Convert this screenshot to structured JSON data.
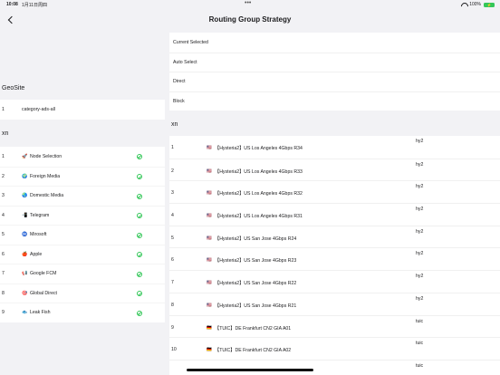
{
  "status": {
    "time": "10:08",
    "date": "1月11日周四",
    "battery": "100%"
  },
  "nav": {
    "title": "Routing Group Strategy"
  },
  "geosite": {
    "header": "GeoSite",
    "items": [
      {
        "num": "1",
        "label": "category-ads-all"
      }
    ]
  },
  "left_xn": {
    "header": "xn",
    "items": [
      {
        "num": "1",
        "icon": "🚀",
        "label": "Node Selection"
      },
      {
        "num": "2",
        "icon": "🌍",
        "label": "Foreign Media"
      },
      {
        "num": "3",
        "icon": "🌏",
        "label": "Domestic Media"
      },
      {
        "num": "4",
        "icon": "📲",
        "label": "Telegram"
      },
      {
        "num": "5",
        "icon": "Ⓜ️",
        "label": "Mirosoft"
      },
      {
        "num": "6",
        "icon": "🍎",
        "label": "Apple"
      },
      {
        "num": "7",
        "icon": "📢",
        "label": "Google FCM"
      },
      {
        "num": "8",
        "icon": "🎯",
        "label": "Global Direct"
      },
      {
        "num": "9",
        "icon": "🐟",
        "label": "Leak Fish"
      }
    ]
  },
  "modes": [
    "Current Selected",
    "Auto Select",
    "Direct",
    "Block"
  ],
  "right_xn": {
    "header": "xn",
    "proxies": [
      {
        "num": "1",
        "flag": "🇺🇸",
        "name": "【Hysteria2】US Los Angeles  4Gbps R34",
        "type": "hy2"
      },
      {
        "num": "2",
        "flag": "🇺🇸",
        "name": "【Hysteria2】US Los Angeles  4Gbps R33",
        "type": "hy2"
      },
      {
        "num": "3",
        "flag": "🇺🇸",
        "name": "【Hysteria2】US Los Angeles  4Gbps R32",
        "type": "hy2"
      },
      {
        "num": "4",
        "flag": "🇺🇸",
        "name": "【Hysteria2】US Los Angeles  4Gbps R31",
        "type": "hy2"
      },
      {
        "num": "5",
        "flag": "🇺🇸",
        "name": "【Hysteria2】US San Jose  4Gbps R24",
        "type": "hy2"
      },
      {
        "num": "6",
        "flag": "🇺🇸",
        "name": "【Hysteria2】US San Jose  4Gbps R23",
        "type": "hy2"
      },
      {
        "num": "7",
        "flag": "🇺🇸",
        "name": "【Hysteria2】US San Jose  4Gbps R22",
        "type": "hy2"
      },
      {
        "num": "8",
        "flag": "🇺🇸",
        "name": "【Hysteria2】US San Jose  4Gbps R21",
        "type": "hy2"
      },
      {
        "num": "9",
        "flag": "🇩🇪",
        "name": "【TUIC】DE Frankfurt  CN2 GIA A01",
        "type": "tuic"
      },
      {
        "num": "10",
        "flag": "🇩🇪",
        "name": "【TUIC】DE Frankfurt  CN2 GIA A02",
        "type": "tuic"
      },
      {
        "num": "",
        "flag": "",
        "name": "",
        "type": "tuic"
      }
    ]
  }
}
